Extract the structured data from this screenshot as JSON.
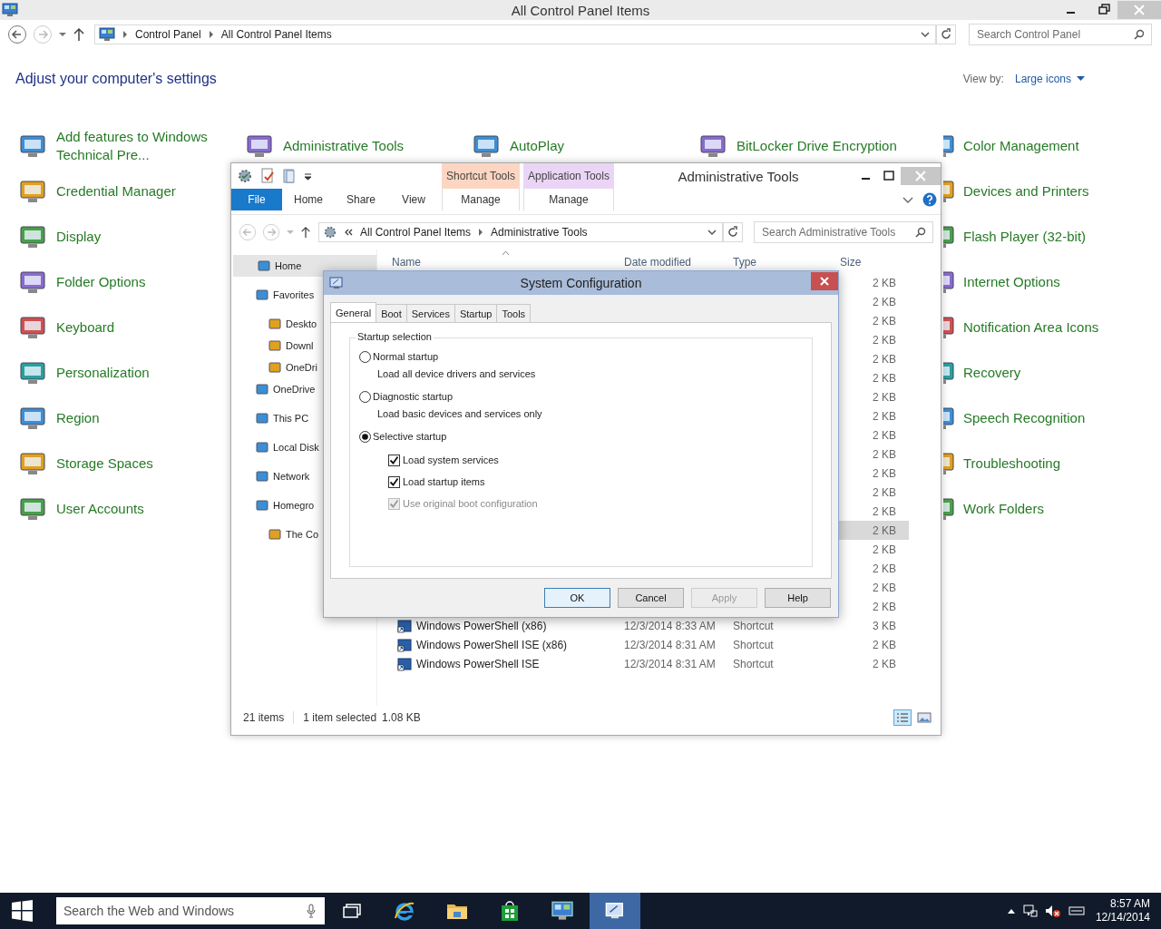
{
  "window": {
    "title": "All Control Panel Items"
  },
  "address": {
    "crumbs": [
      "Control Panel",
      "All Control Panel Items"
    ],
    "search_placeholder": "Search Control Panel"
  },
  "heading": "Adjust your computer's settings",
  "view_by": {
    "label": "View by:",
    "value": "Large icons"
  },
  "control_panel": {
    "columns": [
      [
        {
          "label": "Add features to Windows Technical Pre..."
        },
        {
          "label": "Credential Manager"
        },
        {
          "label": "Display"
        },
        {
          "label": "Folder Options"
        },
        {
          "label": "Keyboard"
        },
        {
          "label": "Personalization"
        },
        {
          "label": "Region"
        },
        {
          "label": "Storage Spaces"
        },
        {
          "label": "User Accounts"
        }
      ],
      [
        {
          "label": "Administrative Tools"
        }
      ],
      [
        {
          "label": "AutoPlay"
        }
      ],
      [
        {
          "label": "BitLocker Drive Encryption"
        }
      ],
      [
        {
          "label": "Color Management"
        },
        {
          "label": "Devices and Printers"
        },
        {
          "label": "Flash Player (32-bit)"
        },
        {
          "label": "Internet Options"
        },
        {
          "label": "Notification Area Icons"
        },
        {
          "label": "Recovery"
        },
        {
          "label": "Speech Recognition"
        },
        {
          "label": "Troubleshooting"
        },
        {
          "label": "Work Folders"
        }
      ]
    ]
  },
  "explorer": {
    "title": "Administrative Tools",
    "ribbon": {
      "file": "File",
      "tabs": [
        "Home",
        "Share",
        "View"
      ],
      "contexts": [
        {
          "label": "Shortcut Tools",
          "color": "#fcd6c2",
          "tab": "Manage"
        },
        {
          "label": "Application Tools",
          "color": "#ead5f7",
          "tab": "Manage"
        }
      ]
    },
    "address": {
      "crumbs": [
        "All Control Panel Items",
        "Administrative Tools"
      ],
      "search_placeholder": "Search Administrative Tools"
    },
    "nav": [
      {
        "label": "Home",
        "selected": true
      },
      {
        "label": "Favorites",
        "selected": false,
        "children": [
          {
            "label": "Deskto",
            "selected": false
          },
          {
            "label": "Downl",
            "selected": false
          },
          {
            "label": "OneDri",
            "selected": false
          }
        ]
      },
      {
        "label": "OneDrive",
        "selected": false
      },
      {
        "label": "This PC",
        "selected": false
      },
      {
        "label": "Local Disk",
        "selected": false
      },
      {
        "label": "Network",
        "selected": false
      },
      {
        "label": "Homegro",
        "selected": false,
        "children": [
          {
            "label": "The Co",
            "selected": false
          }
        ]
      }
    ],
    "columns": [
      "Name",
      "Date modified",
      "Type",
      "Size"
    ],
    "rows": [
      {
        "size": "2 KB",
        "selected": false
      },
      {
        "size": "2 KB",
        "selected": false
      },
      {
        "size": "2 KB",
        "selected": false
      },
      {
        "size": "2 KB",
        "selected": false
      },
      {
        "size": "2 KB",
        "selected": false
      },
      {
        "size": "2 KB",
        "selected": false
      },
      {
        "size": "2 KB",
        "selected": false
      },
      {
        "size": "2 KB",
        "selected": false
      },
      {
        "size": "2 KB",
        "selected": false
      },
      {
        "size": "2 KB",
        "selected": false
      },
      {
        "size": "2 KB",
        "selected": false
      },
      {
        "size": "2 KB",
        "selected": false
      },
      {
        "size": "2 KB",
        "selected": false
      },
      {
        "size": "2 KB",
        "selected": true
      },
      {
        "size": "2 KB",
        "selected": false
      },
      {
        "size": "2 KB",
        "selected": false
      },
      {
        "size": "2 KB",
        "selected": false
      },
      {
        "size": "2 KB",
        "selected": false
      },
      {
        "name": "Windows PowerShell (x86)",
        "date": "12/3/2014 8:33 AM",
        "type": "Shortcut",
        "size": "3 KB",
        "selected": false
      },
      {
        "name": "Windows PowerShell ISE (x86)",
        "date": "12/3/2014 8:31 AM",
        "type": "Shortcut",
        "size": "2 KB",
        "selected": false
      },
      {
        "name": "Windows PowerShell ISE",
        "date": "12/3/2014 8:31 AM",
        "type": "Shortcut",
        "size": "2 KB",
        "selected": false
      }
    ],
    "status": {
      "count": "21 items",
      "selection": "1 item selected",
      "size": "1.08 KB"
    }
  },
  "dialog": {
    "title": "System Configuration",
    "tabs": [
      {
        "label": "General",
        "selected": true
      },
      {
        "label": "Boot",
        "selected": false
      },
      {
        "label": "Services",
        "selected": false
      },
      {
        "label": "Startup",
        "selected": false
      },
      {
        "label": "Tools",
        "selected": false
      }
    ],
    "group": "Startup selection",
    "radios": [
      {
        "label": "Normal startup",
        "description": "Load all device drivers and services",
        "selected": false
      },
      {
        "label": "Diagnostic startup",
        "description": "Load basic devices and services only",
        "selected": false
      },
      {
        "label": "Selective startup",
        "selected": true
      }
    ],
    "checkboxes": [
      {
        "label": "Load system services",
        "checked": true,
        "disabled": false
      },
      {
        "label": "Load startup items",
        "checked": true,
        "disabled": false
      },
      {
        "label": "Use original boot configuration",
        "checked": true,
        "disabled": true
      }
    ],
    "buttons": [
      {
        "label": "OK",
        "default": true,
        "disabled": false
      },
      {
        "label": "Cancel",
        "default": false,
        "disabled": false
      },
      {
        "label": "Apply",
        "default": false,
        "disabled": true
      },
      {
        "label": "Help",
        "default": false,
        "disabled": false
      }
    ]
  },
  "taskbar": {
    "search_placeholder": "Search the Web and Windows",
    "apps": [
      {
        "kind": "taskview",
        "active": false
      },
      {
        "kind": "browser",
        "active": false
      },
      {
        "kind": "folder",
        "active": false
      },
      {
        "kind": "store",
        "active": false
      },
      {
        "kind": "panel",
        "active": false
      },
      {
        "kind": "config",
        "active": true
      }
    ],
    "time": "8:57 AM",
    "date": "12/14/2014"
  }
}
